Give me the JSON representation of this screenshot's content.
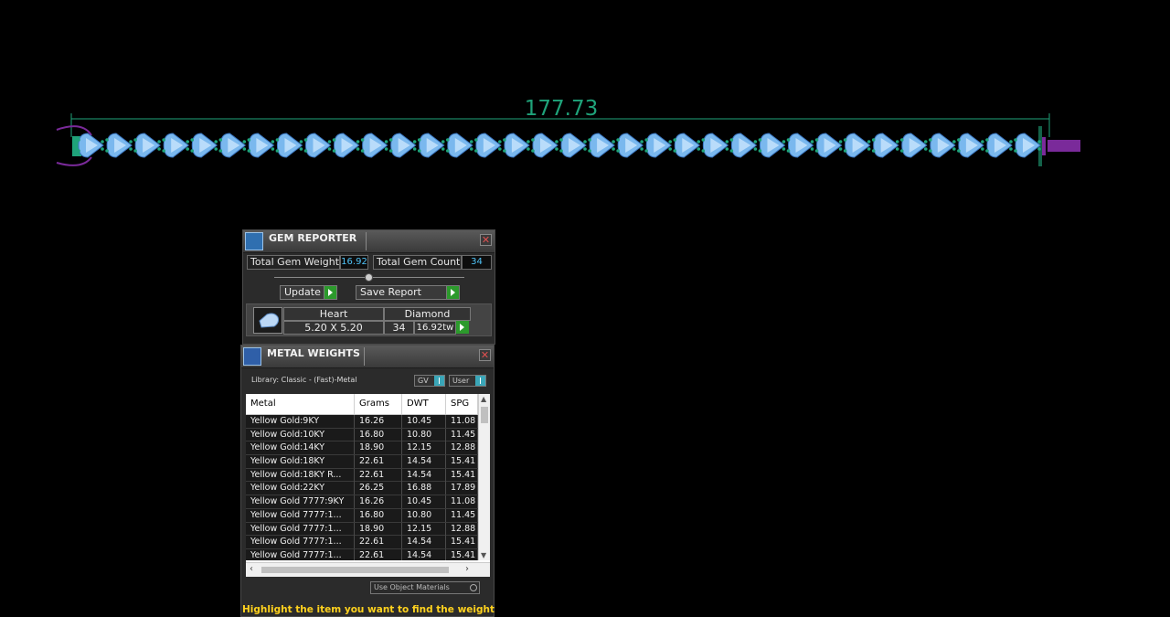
{
  "viewport": {
    "dimension_label": "177.73"
  },
  "gem_reporter": {
    "title": "GEM REPORTER",
    "total_gem_weight_label": "Total Gem Weight",
    "total_gem_weight_value": "16.92",
    "total_gem_count_label": "Total Gem Count",
    "total_gem_count_value": "34",
    "update_label": "Update",
    "save_report_label": "Save Report",
    "gem": {
      "shape": "Heart",
      "size": "5.20 X 5.20",
      "material": "Diamond",
      "count": "34",
      "weight": "16.92tw"
    },
    "colors": {
      "value_text": "#4fc3f7",
      "go_button": "#2c9a2c"
    }
  },
  "metal_weights": {
    "title": "METAL WEIGHTS",
    "library_label": "Library: Classic - (Fast)-Metal",
    "gv_label": "GV",
    "user_label": "User",
    "columns": [
      "Metal",
      "Grams",
      "DWT",
      "SPG"
    ],
    "rows": [
      [
        "Yellow Gold:9KY",
        "16.26",
        "10.45",
        "11.08"
      ],
      [
        "Yellow Gold:10KY",
        "16.80",
        "10.80",
        "11.45"
      ],
      [
        "Yellow Gold:14KY",
        "18.90",
        "12.15",
        "12.88"
      ],
      [
        "Yellow Gold:18KY",
        "22.61",
        "14.54",
        "15.41"
      ],
      [
        "Yellow Gold:18KY R...",
        "22.61",
        "14.54",
        "15.41"
      ],
      [
        "Yellow Gold:22KY",
        "26.25",
        "16.88",
        "17.89"
      ],
      [
        "Yellow Gold 7777:9KY",
        "16.26",
        "10.45",
        "11.08"
      ],
      [
        "Yellow Gold 7777:1...",
        "16.80",
        "10.80",
        "11.45"
      ],
      [
        "Yellow Gold 7777:1...",
        "18.90",
        "12.15",
        "12.88"
      ],
      [
        "Yellow Gold 7777:1...",
        "22.61",
        "14.54",
        "15.41"
      ],
      [
        "Yellow Gold 7777:1...",
        "22.61",
        "14.54",
        "15.41"
      ]
    ],
    "use_object_materials_label": "Use Object Materials",
    "hint": "Highlight the item you want to find the weight",
    "colors": {
      "hint": "#ffd21e",
      "indicator": "#3aa6b8"
    }
  },
  "colors": {
    "gem_fill": "#7ab8ee",
    "prong": "#1fa37a",
    "clasp": "#7a2a9a",
    "dimension": "#1fa37a"
  }
}
